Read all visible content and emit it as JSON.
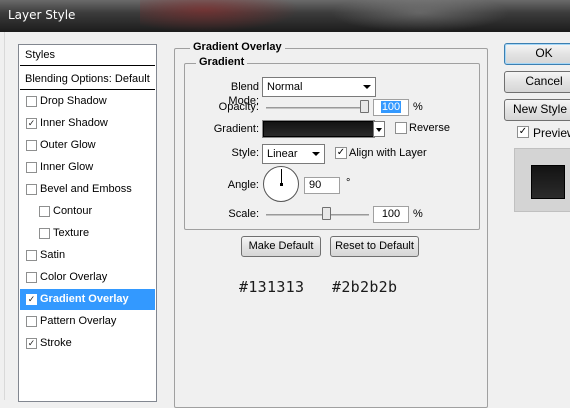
{
  "window": {
    "title": "Layer Style"
  },
  "styles_list": {
    "header": "Styles",
    "blending": "Blending Options: Default",
    "items": [
      {
        "label": "Drop Shadow",
        "checked": false
      },
      {
        "label": "Inner Shadow",
        "checked": true
      },
      {
        "label": "Outer Glow",
        "checked": false
      },
      {
        "label": "Inner Glow",
        "checked": false
      },
      {
        "label": "Bevel and Emboss",
        "checked": false
      },
      {
        "label": "Contour",
        "checked": false
      },
      {
        "label": "Texture",
        "checked": false
      },
      {
        "label": "Satin",
        "checked": false
      },
      {
        "label": "Color Overlay",
        "checked": false
      },
      {
        "label": "Gradient Overlay",
        "checked": true,
        "selected": true
      },
      {
        "label": "Pattern Overlay",
        "checked": false
      },
      {
        "label": "Stroke",
        "checked": true
      }
    ]
  },
  "gradient_overlay": {
    "section_title": "Gradient Overlay",
    "group_title": "Gradient",
    "blend_mode_label": "Blend Mode:",
    "blend_mode_value": "Normal",
    "opacity_label": "Opacity:",
    "opacity_value": "100",
    "opacity_unit": "%",
    "opacity_level": 1.0,
    "gradient_label": "Gradient:",
    "reverse_label": "Reverse",
    "reverse_checked": false,
    "style_label": "Style:",
    "style_value": "Linear",
    "align_label": "Align with Layer",
    "align_checked": true,
    "angle_label": "Angle:",
    "angle_value": "90",
    "angle_unit": "°",
    "scale_label": "Scale:",
    "scale_value": "100",
    "scale_unit": "%",
    "scale_level": 0.6,
    "make_default": "Make Default",
    "reset_default": "Reset to Default"
  },
  "colors": {
    "start": "#131313",
    "end": "#2b2b2b"
  },
  "color_labels": {
    "start": "#131313",
    "end": "#2b2b2b"
  },
  "actions": {
    "ok": "OK",
    "cancel": "Cancel",
    "new_style": "New Style",
    "preview_label": "Preview",
    "preview_checked": true
  }
}
